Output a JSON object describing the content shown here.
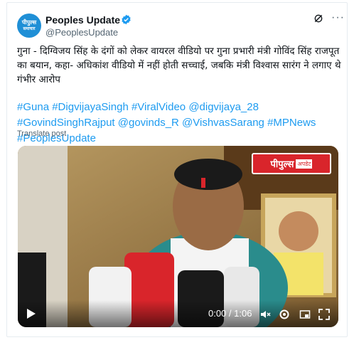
{
  "post": {
    "author_name": "Peoples Update",
    "handle": "@PeoplesUpdate",
    "avatar_text_line1": "पीपुल्स",
    "avatar_text_line2": "समाचार",
    "text": "गुना - दिग्विजय सिंह के दंगों को लेकर वायरल वीडियो पर गुना प्रभारी मंत्री गोविंद सिंह राजपूत का बयान, कहा- अधिकांश वीडियो में नहीं होती सच्चाई, जबकि मंत्री विश्वास सारंग ने लगाए थे गंभीर आरोप",
    "hashtags": [
      "#Guna",
      "#DigvijayaSingh",
      "#ViralVideo",
      "@digvijaya_28",
      "#GovindSinghRajput",
      "@govinds_R",
      "@VishvasSarang",
      "#MPNews",
      "#PeoplesUpdate"
    ],
    "translate_label": "Translate post"
  },
  "video": {
    "badge_main": "पीपुल्स",
    "badge_sub": "अपडेट",
    "time": "0:00 / 1:06"
  },
  "colors": {
    "link": "#1d9bf0",
    "verified": "#1d9bf0",
    "badge": "#d9252b"
  }
}
